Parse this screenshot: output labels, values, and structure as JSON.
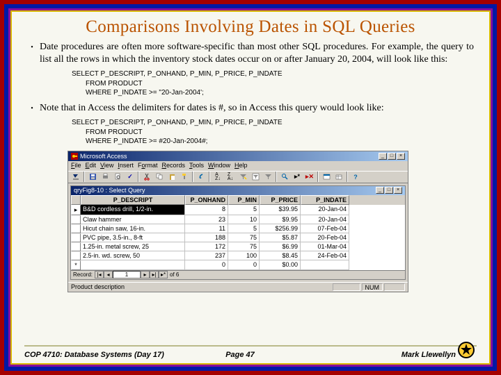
{
  "title": "Comparisons Involving Dates in SQL Queries",
  "bullets": [
    "Date procedures are often more software-specific than most other SQL procedures. For example, the query to list all the rows in which the inventory stock dates occur on or after January 20, 2004, will look like this:",
    "Note that in Access the delimiters for dates is #, so in Access this query would look like:"
  ],
  "code1": {
    "l1": "SELECT  P_DESCRIPT, P_ONHAND, P_MIN, P_PRICE, P_INDATE",
    "l2": "FROM PRODUCT",
    "l3": "WHERE P_INDATE >= \"20-Jan-2004';"
  },
  "code2": {
    "l1": "SELECT  P_DESCRIPT, P_ONHAND, P_MIN, P_PRICE, P_INDATE",
    "l2": "FROM PRODUCT",
    "l3": "WHERE P_INDATE >= #20-Jan-2004#;"
  },
  "access": {
    "app_title": "Microsoft Access",
    "menus": [
      "File",
      "Edit",
      "View",
      "Insert",
      "Format",
      "Records",
      "Tools",
      "Window",
      "Help"
    ],
    "inner_title": "qryFig8-10 : Select Query",
    "columns": [
      "P_DESCRIPT",
      "P_ONHAND",
      "P_MIN",
      "P_PRICE",
      "P_INDATE"
    ],
    "rows": [
      [
        "B&D cordless drill, 1/2-in.",
        "8",
        "5",
        "$39.95",
        "20-Jan-04"
      ],
      [
        "Claw hammer",
        "23",
        "10",
        "$9.95",
        "20-Jan-04"
      ],
      [
        "Hicut chain saw, 16-in.",
        "11",
        "5",
        "$256.99",
        "07-Feb-04"
      ],
      [
        "PVC pipe, 3.5-in., 8-ft",
        "188",
        "75",
        "$5.87",
        "20-Feb-04"
      ],
      [
        "1.25-in. metal screw, 25",
        "172",
        "75",
        "$6.99",
        "01-Mar-04"
      ],
      [
        "2.5-in. wd. screw, 50",
        "237",
        "100",
        "$8.45",
        "24-Feb-04"
      ],
      [
        "",
        "0",
        "0",
        "$0.00",
        ""
      ]
    ],
    "record_pos": "1",
    "record_count": "of 6",
    "status_left": "Product description",
    "status_num": "NUM"
  },
  "footer": {
    "left": "COP 4710: Database Systems  (Day 17)",
    "center": "Page 47",
    "right": "Mark Llewellyn"
  }
}
